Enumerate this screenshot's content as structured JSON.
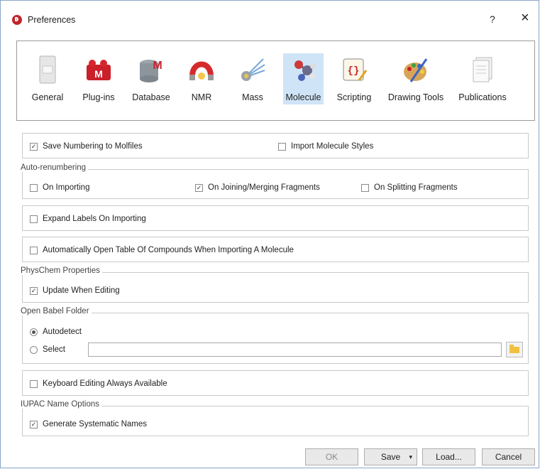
{
  "window": {
    "title": "Preferences",
    "help_label": "?",
    "close_label": "×"
  },
  "categories": [
    {
      "label": "General",
      "icon": "general-icon",
      "selected": false
    },
    {
      "label": "Plug-ins",
      "icon": "plugins-icon",
      "selected": false
    },
    {
      "label": "Database",
      "icon": "database-icon",
      "selected": false
    },
    {
      "label": "NMR",
      "icon": "nmr-icon",
      "selected": false
    },
    {
      "label": "Mass",
      "icon": "mass-icon",
      "selected": false
    },
    {
      "label": "Molecule",
      "icon": "molecule-icon",
      "selected": true
    },
    {
      "label": "Scripting",
      "icon": "scripting-icon",
      "selected": false
    },
    {
      "label": "Drawing Tools",
      "icon": "drawing-tools-icon",
      "selected": false
    },
    {
      "label": "Publications",
      "icon": "publications-icon",
      "selected": false
    }
  ],
  "options": {
    "save_numbering": {
      "label": "Save Numbering to Molfiles",
      "checked": true
    },
    "import_styles": {
      "label": "Import Molecule Styles",
      "checked": false
    },
    "auto_renumbering": {
      "title": "Auto-renumbering",
      "on_importing": {
        "label": "On Importing",
        "checked": false
      },
      "on_joining": {
        "label": "On Joining/Merging Fragments",
        "checked": true
      },
      "on_splitting": {
        "label": "On Splitting Fragments",
        "checked": false
      }
    },
    "expand_labels": {
      "label": "Expand Labels On Importing",
      "checked": false
    },
    "open_table": {
      "label": "Automatically Open Table Of Compounds When Importing A Molecule",
      "checked": false
    },
    "physchem": {
      "title": "PhysChem Properties",
      "update_editing": {
        "label": "Update When Editing",
        "checked": true
      }
    },
    "open_babel": {
      "title": "Open Babel Folder",
      "autodetect": {
        "label": "Autodetect",
        "selected": true
      },
      "select": {
        "label": "Select",
        "selected": false
      },
      "path": ""
    },
    "keyboard_editing": {
      "label": "Keyboard Editing Always Available",
      "checked": false
    },
    "iupac": {
      "title": "IUPAC Name Options",
      "systematic": {
        "label": "Generate Systematic Names",
        "checked": true
      }
    }
  },
  "buttons": {
    "ok": "OK",
    "save": "Save",
    "save_arrow": "▾",
    "load": "Load...",
    "cancel": "Cancel"
  },
  "colors": {
    "selection": "#cfe4f7",
    "app_icon": "#c0262c",
    "folder": "#f0c040"
  }
}
